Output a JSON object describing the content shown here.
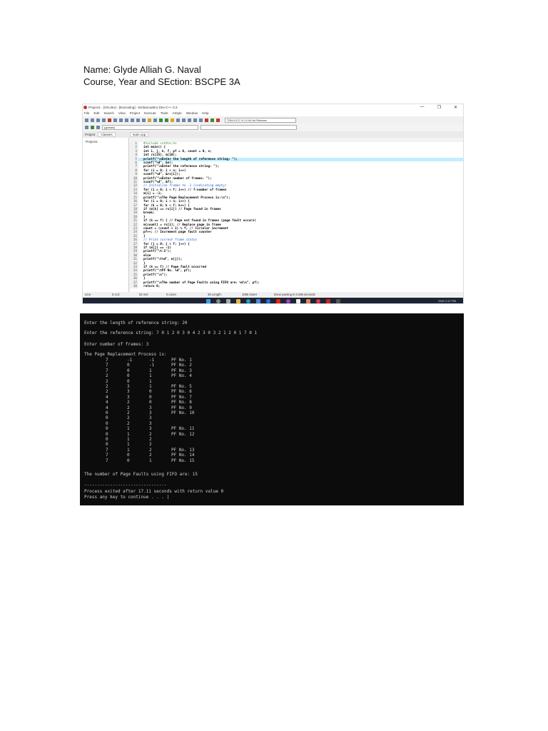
{
  "header": {
    "name": "Name: Glyde Alliah G. Naval",
    "course": "Course, Year and SEction: BSCPE 3A"
  },
  "ide": {
    "title": "Project1 - [OS.dev] - [Executing] - Embarcadero Dev-C++ 6.3",
    "window_buttons": [
      "—",
      "❐",
      "✕"
    ],
    "menu": [
      "File",
      "Edit",
      "Search",
      "View",
      "Project",
      "Execute",
      "Tools",
      "AStyle",
      "Window",
      "Help"
    ],
    "compiler": "TDM-GCC 9.2.0 64-bit Release",
    "scope": "(globals)",
    "panel_tabs": [
      "Project",
      "Classes"
    ],
    "file_tab": "main.cpp",
    "project_item": "Project1",
    "code": [
      "#include <stdio.h>",
      "int main() {",
      "int i, j, k, f, pf = 0, count = 0, n;",
      "int rs[25], m[10];",
      "printf(\"\\nEnter the length of reference string: \");",
      "scanf(\"%d\", &n);",
      "printf(\"\\nEnter the reference string: \");",
      "for (i = 0; i < n; i++)",
      "scanf(\"%d\", &rs[i]);",
      "printf(\"\\nEnter number of frames: \");",
      "scanf(\"%d\", &f);",
      "// Initialize frames to -1 (indicating empty)",
      "for (i = 0; i < f; i++) // f-number of frames",
      "m[i] = -1;",
      "printf(\"\\nThe Page Replacement Process is:\\n\");",
      "for (i = 0; i < n; i++) {",
      "for (k = 0; k < f; k++) {",
      "if (m[k] == rs[i]) // Page found in frames",
      "break;",
      "}",
      "if (k == f) { // Page not found in frames (page fault occurs)",
      "m[count] = rs[i]; // Replace page in frame",
      "count = (count + 1) % f; // Circular increment",
      "pf++; // Increment page fault counter",
      "}",
      "// Print current frame status",
      "for (j = 0; j < f; j++) {",
      "if (m[j] == -1)",
      "printf(\"\\t-1\");",
      "else",
      "printf(\"\\t%d\", m[j]);",
      "}",
      "if (k == f) // Page fault occurred",
      "printf(\"\\tPF No. %d\", pf);",
      "printf(\"\\n\");",
      "}",
      "printf(\"\\nThe number of Page Faults using FIFO are: %d\\n\", pf);",
      "return 0;"
    ],
    "status": [
      "Line:",
      "5 Col:",
      "52 Sel:",
      "0 Lines:",
      "38 Length:",
      "1055 Insert",
      "Done parsing in 0.266 seconds"
    ],
    "tray": "ENG   2:47 PM"
  },
  "console": {
    "len_prompt": "Enter the length of reference string: 20",
    "ref_prompt": "Enter the reference string: 7 0 1 2 0 3 0 4 2 3 0 3 2 1 2 0 1 7 0 1",
    "frames_prompt": "Enter number of frames: 3",
    "heading": "The Page Replacement Process is:",
    "rows": [
      [
        "7",
        "-1",
        "-1",
        "PF No. 1"
      ],
      [
        "7",
        "0",
        "-1",
        "PF No. 2"
      ],
      [
        "7",
        "0",
        "1",
        "PF No. 3"
      ],
      [
        "2",
        "0",
        "1",
        "PF No. 4"
      ],
      [
        "2",
        "0",
        "1",
        ""
      ],
      [
        "2",
        "3",
        "1",
        "PF No. 5"
      ],
      [
        "2",
        "3",
        "0",
        "PF No. 6"
      ],
      [
        "4",
        "3",
        "0",
        "PF No. 7"
      ],
      [
        "4",
        "2",
        "0",
        "PF No. 8"
      ],
      [
        "4",
        "2",
        "3",
        "PF No. 9"
      ],
      [
        "0",
        "2",
        "3",
        "PF No. 10"
      ],
      [
        "0",
        "2",
        "3",
        ""
      ],
      [
        "0",
        "2",
        "3",
        ""
      ],
      [
        "0",
        "1",
        "3",
        "PF No. 11"
      ],
      [
        "0",
        "1",
        "2",
        "PF No. 12"
      ],
      [
        "0",
        "1",
        "2",
        ""
      ],
      [
        "0",
        "1",
        "2",
        ""
      ],
      [
        "7",
        "1",
        "2",
        "PF No. 13"
      ],
      [
        "7",
        "0",
        "2",
        "PF No. 14"
      ],
      [
        "7",
        "0",
        "1",
        "PF No. 15"
      ]
    ],
    "result": "The number of Page Faults using FIFO are: 15",
    "separator": "--------------------------------",
    "exit": "Process exited after 17.11 seconds with return value 0",
    "continue": "Press any key to continue . . . |"
  }
}
